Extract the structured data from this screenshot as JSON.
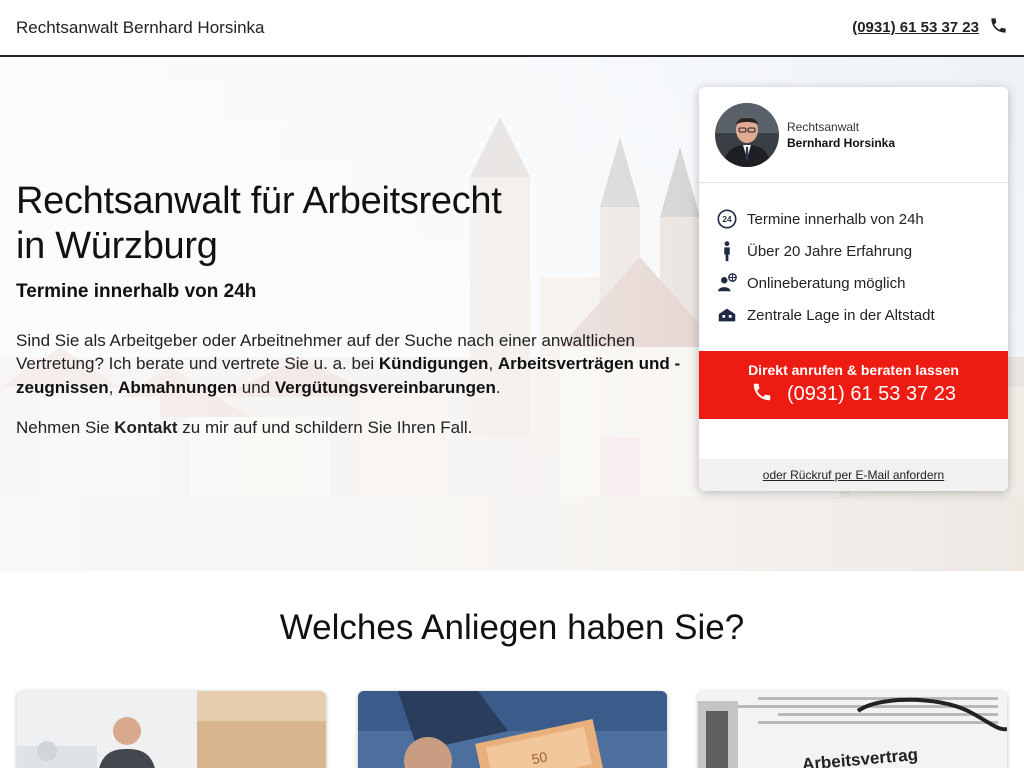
{
  "header": {
    "brand": "Rechtsanwalt Bernhard Horsinka",
    "phone": "(0931) 61 53 37 23",
    "phone_icon": "phone-icon"
  },
  "hero": {
    "title_line1": "Rechtsanwalt für Arbeitsrecht",
    "title_line2": "in Würzburg",
    "subtitle": "Termine innerhalb von 24h",
    "text": {
      "p1": "Sind Sie als Arbeitgeber oder Arbeitnehmer auf der Suche nach einer anwaltlichen Vertretung? Ich berate und vertrete Sie u. a. bei ",
      "k1": "Kündigungen",
      "sep1": ", ",
      "k2": "Arbeitsverträgen und -zeugnissen",
      "sep2": ", ",
      "k3": "Abmahnungen",
      "sep3": " und ",
      "k4": "Vergütungsvereinbarungen",
      "end": "."
    },
    "text2": {
      "a": "Nehmen Sie ",
      "b": "Kontakt",
      "c": " zu mir auf und schildern Sie Ihren Fall."
    }
  },
  "card": {
    "role": "Rechtsanwalt",
    "name": "Bernhard Horsinka",
    "features": [
      {
        "icon": "clock-24h-icon",
        "label": "Termine innerhalb von 24h"
      },
      {
        "icon": "person-briefcase-icon",
        "label": "Über 20 Jahre Erfahrung"
      },
      {
        "icon": "online-consult-icon",
        "label": "Onlineberatung möglich"
      },
      {
        "icon": "house-icon",
        "label": "Zentrale Lage in der Altstadt"
      }
    ],
    "cta_label": "Direkt anrufen & beraten lassen",
    "cta_phone": "(0931) 61 53 37 23",
    "callback_link": "oder Rückruf per E-Mail anfordern",
    "cta_color": "#ee1b13"
  },
  "section": {
    "title": "Welches Anliegen haben Sie?",
    "tiles": [
      {
        "image": "office-meeting-photo"
      },
      {
        "image": "euro-banknotes-photo"
      },
      {
        "image": "arbeitsvertrag-document-photo",
        "caption": "Arbeitsvertrag"
      }
    ]
  }
}
